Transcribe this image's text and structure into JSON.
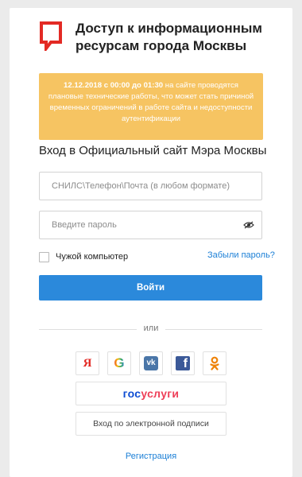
{
  "header": {
    "title": "Доступ к информационным ресурсам города Москвы"
  },
  "notice": {
    "date": "12.12.2018",
    "c": "с",
    "from_time": "00:00",
    "do": "до",
    "to_time": "01:30",
    "text": " на сайте проводятся плановые технические работы, что может стать причиной временных ограничений в работе сайта и недоступности аутентификации"
  },
  "login": {
    "heading": "Вход в Официальный сайт Мэра Москвы",
    "login_placeholder": "СНИЛС\\Телефон\\Почта (в любом формате)",
    "password_placeholder": "Введите пароль",
    "remember_label": "Чужой компьютер",
    "forgot_link": "Забыли пароль?",
    "submit_label": "Войти"
  },
  "alt": {
    "or_label": "или",
    "social": [
      "yandex-icon",
      "google-icon",
      "vk-icon",
      "facebook-icon",
      "odnoklassniki-icon"
    ],
    "social_text": {
      "yandex": "Я",
      "google": "G",
      "vk": "vk",
      "facebook": "f"
    },
    "gosuslugi_part1": "гос",
    "gosuslugi_part2": "услуги",
    "signature_label": "Вход по электронной подписи"
  },
  "footer": {
    "register_link": "Регистрация"
  },
  "colors": {
    "brand_red": "#e32a24",
    "primary_blue": "#2b89db",
    "notice_bg": "#f6c462",
    "gos_blue": "#0d4cd3",
    "gos_red": "#ee3f58"
  }
}
